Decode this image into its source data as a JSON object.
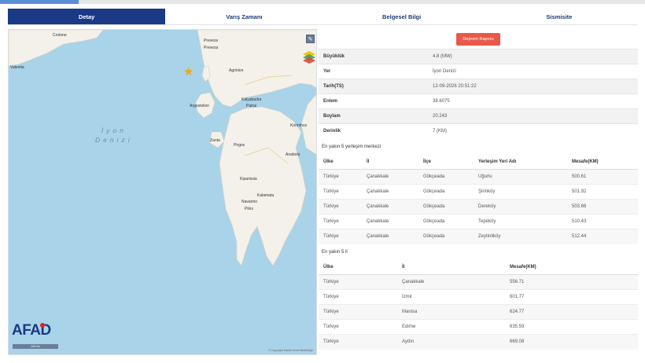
{
  "tabs": [
    {
      "label": "Detay",
      "active": true
    },
    {
      "label": "Varış Zamanı",
      "active": false
    },
    {
      "label": "Belgesel Bilgi",
      "active": false
    },
    {
      "label": "Sismisite",
      "active": false
    }
  ],
  "map": {
    "labels": {
      "crotone": "Crotone",
      "valentia": "Valentia",
      "preveze": "Preveze",
      "preveza": "Preveza",
      "agrinion": "Agrinion",
      "argostolion": "Argostolion",
      "kalyabadra": "Kalyabadra",
      "patrai": "Patrai",
      "korinthos": "Korinthos",
      "zanta": "Zanta",
      "pirgos": "Pirgos",
      "anabolu": "Anabolu",
      "kiparissia": "Kiparissia",
      "kalamata": "Kalamata",
      "navarino": "Navarino",
      "pilos": "Pilos",
      "sea": "İyon\nDenizi"
    },
    "logo": "AFAD",
    "scale_label": "100 km",
    "copyright": "© Copyright Harita Genel Müdürlüğü",
    "marker_color": "#f0a818"
  },
  "report_button": "Deprem Raporu",
  "details": [
    {
      "key": "Büyüklük",
      "value": "4.8 (MW)"
    },
    {
      "key": "Yer",
      "value": "İyon Denizi"
    },
    {
      "key": "Tarih(TS)",
      "value": "12-09-2026 20:51:22"
    },
    {
      "key": "Enlem",
      "value": "38.6075"
    },
    {
      "key": "Boylam",
      "value": "20.243"
    },
    {
      "key": "Derinlik",
      "value": "7 (KM)"
    }
  ],
  "settlements": {
    "title": "En yakın 5 yerleşim merkezi",
    "headers": [
      "Ülke",
      "İl",
      "İlçe",
      "Yerleşim Yeri Adı",
      "Mesafe(KM)"
    ],
    "rows": [
      [
        "Türkiye",
        "Çanakkale",
        "Gökçeada",
        "Uğurlu",
        "500.61"
      ],
      [
        "Türkiye",
        "Çanakkale",
        "Gökçeada",
        "Şirinköy",
        "501.92"
      ],
      [
        "Türkiye",
        "Çanakkale",
        "Gökçeada",
        "Dereköy",
        "503.66"
      ],
      [
        "Türkiye",
        "Çanakkale",
        "Gökçeada",
        "Tepeköy",
        "510.43"
      ],
      [
        "Türkiye",
        "Çanakkale",
        "Gökçeada",
        "Zeytinliköy",
        "512.44"
      ]
    ]
  },
  "provinces": {
    "title": "En yakın 5 il",
    "headers": [
      "Ülke",
      "İl",
      "Mesafe(KM)"
    ],
    "rows": [
      [
        "Türkiye",
        "Çanakkale",
        "556.71"
      ],
      [
        "Türkiye",
        "İzmir",
        "601.77"
      ],
      [
        "Türkiye",
        "Manisa",
        "624.77"
      ],
      [
        "Türkiye",
        "Edirne",
        "635.59"
      ],
      [
        "Türkiye",
        "Aydın",
        "669.08"
      ]
    ]
  },
  "colors": {
    "tab_active": "#1a3a86",
    "report_button": "#e8594c",
    "sea": "#a9d3e9",
    "land": "#f4f1ea"
  }
}
